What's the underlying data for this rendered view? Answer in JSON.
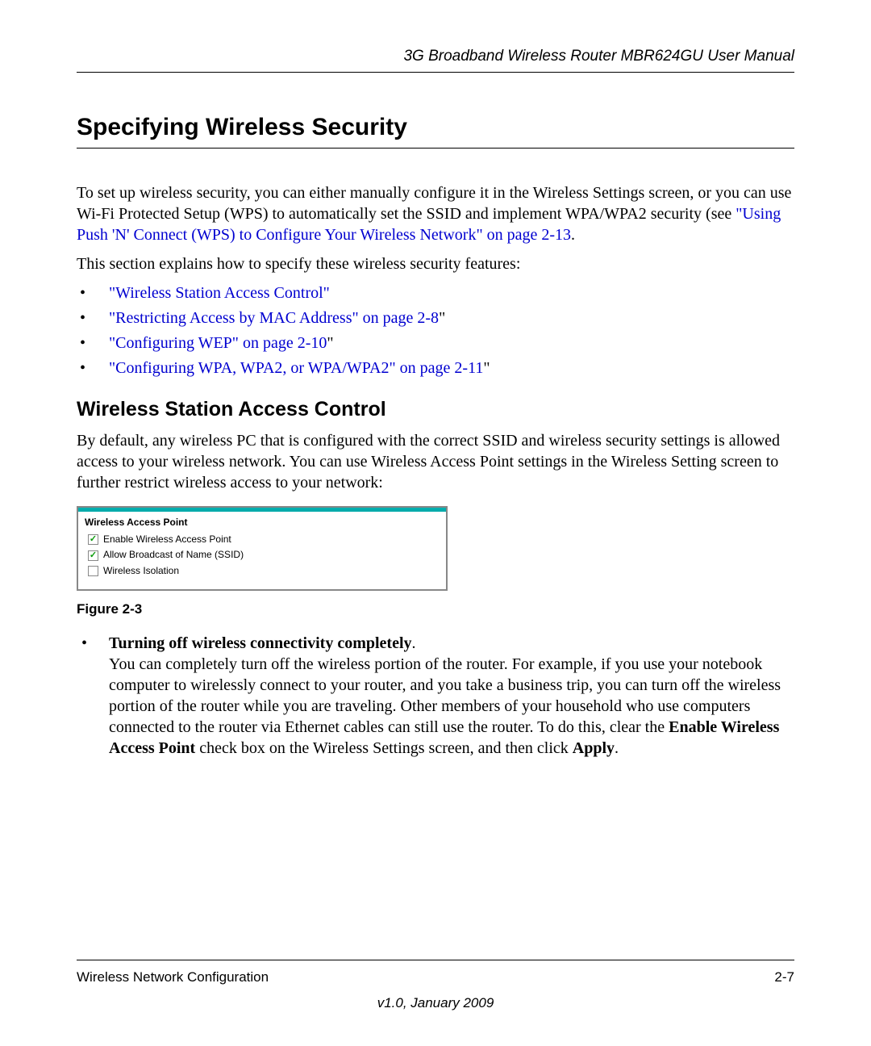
{
  "header": {
    "title": "3G Broadband Wireless Router MBR624GU User Manual"
  },
  "main": {
    "h1": "Specifying Wireless Security",
    "p1a": "To set up wireless security, you can either manually configure it in the Wireless Settings screen, or you can use Wi-Fi Protected Setup (WPS) to automatically set the SSID and implement WPA/WPA2 security (see ",
    "p1_link": "\"Using Push 'N' Connect (WPS) to Configure Your Wireless Network\" on page 2-13",
    "p1b": ".",
    "p2": "This section explains how to specify these wireless security features:",
    "bullets": [
      "\"Wireless Station Access Control\"",
      "\"Restricting Access by MAC Address\" on page 2-8",
      "\"Configuring WEP\" on page 2-10",
      "\"Configuring WPA, WPA2, or WPA/WPA2\" on page 2-11"
    ],
    "bullet_trail": "\"",
    "h2": "Wireless Station Access Control",
    "p3": "By default, any wireless PC that is configured with the correct SSID and wireless security settings is allowed access to your wireless network. You can use Wireless Access Point settings in the Wireless Setting screen to further restrict wireless access to your network:",
    "screenshot": {
      "heading": "Wireless Access Point",
      "items": [
        {
          "label": "Enable Wireless Access Point",
          "checked": true
        },
        {
          "label": "Allow Broadcast of Name (SSID)",
          "checked": true
        },
        {
          "label": "Wireless Isolation",
          "checked": false
        }
      ]
    },
    "figure_label": "Figure 2-3",
    "sub_item": {
      "lead": "Turning off wireless connectivity completely",
      "period": ".",
      "body_a": "You can completely turn off the wireless portion of the router. For example, if you use your notebook computer to wirelessly connect to your router, and you take a business trip, you can turn off the wireless portion of the router while you are traveling. Other members of your household who use computers connected to the router via Ethernet cables can still use the router. To do this, clear the ",
      "bold1": "Enable Wireless Access Point",
      "body_b": " check box on the Wireless Settings screen, and then click ",
      "bold2": "Apply",
      "body_c": "."
    }
  },
  "footer": {
    "left": "Wireless Network Configuration",
    "right": "2-7",
    "version": "v1.0, January 2009"
  }
}
